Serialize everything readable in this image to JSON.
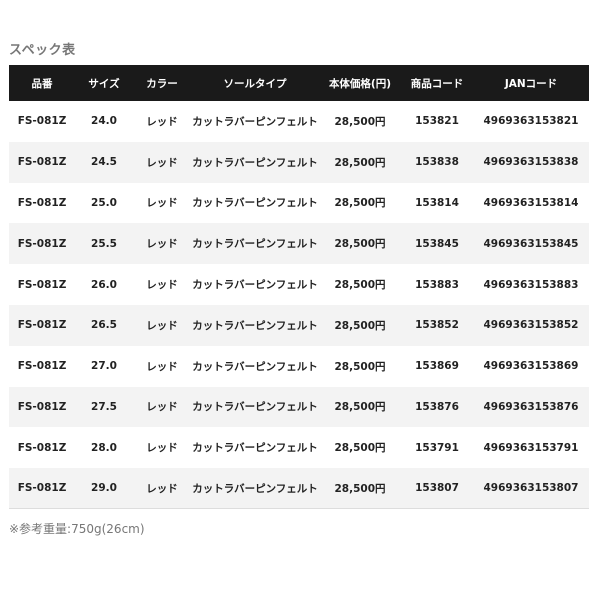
{
  "page": {
    "title": "スペック表",
    "footnote": "※参考重量:750g(26cm)"
  },
  "table": {
    "headers": [
      "品番",
      "サイズ",
      "カラー",
      "ソールタイプ",
      "本体価格(円)",
      "商品コード",
      "JANコード"
    ],
    "rows": [
      [
        "FS-081Z",
        "24.0",
        "レッド",
        "カットラバーピンフェルト",
        "28,500円",
        "153821",
        "4969363153821"
      ],
      [
        "FS-081Z",
        "24.5",
        "レッド",
        "カットラバーピンフェルト",
        "28,500円",
        "153838",
        "4969363153838"
      ],
      [
        "FS-081Z",
        "25.0",
        "レッド",
        "カットラバーピンフェルト",
        "28,500円",
        "153814",
        "4969363153814"
      ],
      [
        "FS-081Z",
        "25.5",
        "レッド",
        "カットラバーピンフェルト",
        "28,500円",
        "153845",
        "4969363153845"
      ],
      [
        "FS-081Z",
        "26.0",
        "レッド",
        "カットラバーピンフェルト",
        "28,500円",
        "153883",
        "4969363153883"
      ],
      [
        "FS-081Z",
        "26.5",
        "レッド",
        "カットラバーピンフェルト",
        "28,500円",
        "153852",
        "4969363153852"
      ],
      [
        "FS-081Z",
        "27.0",
        "レッド",
        "カットラバーピンフェルト",
        "28,500円",
        "153869",
        "4969363153869"
      ],
      [
        "FS-081Z",
        "27.5",
        "レッド",
        "カットラバーピンフェルト",
        "28,500円",
        "153876",
        "4969363153876"
      ],
      [
        "FS-081Z",
        "28.0",
        "レッド",
        "カットラバーピンフェルト",
        "28,500円",
        "153791",
        "4969363153791"
      ],
      [
        "FS-081Z",
        "29.0",
        "レッド",
        "カットラバーピンフェルト",
        "28,500円",
        "153807",
        "4969363153807"
      ]
    ]
  },
  "colors": {
    "header_bg": "#1a1a1a",
    "header_text": "#ffffff",
    "stripe": "#f3f3f3",
    "title_text": "#777777"
  }
}
